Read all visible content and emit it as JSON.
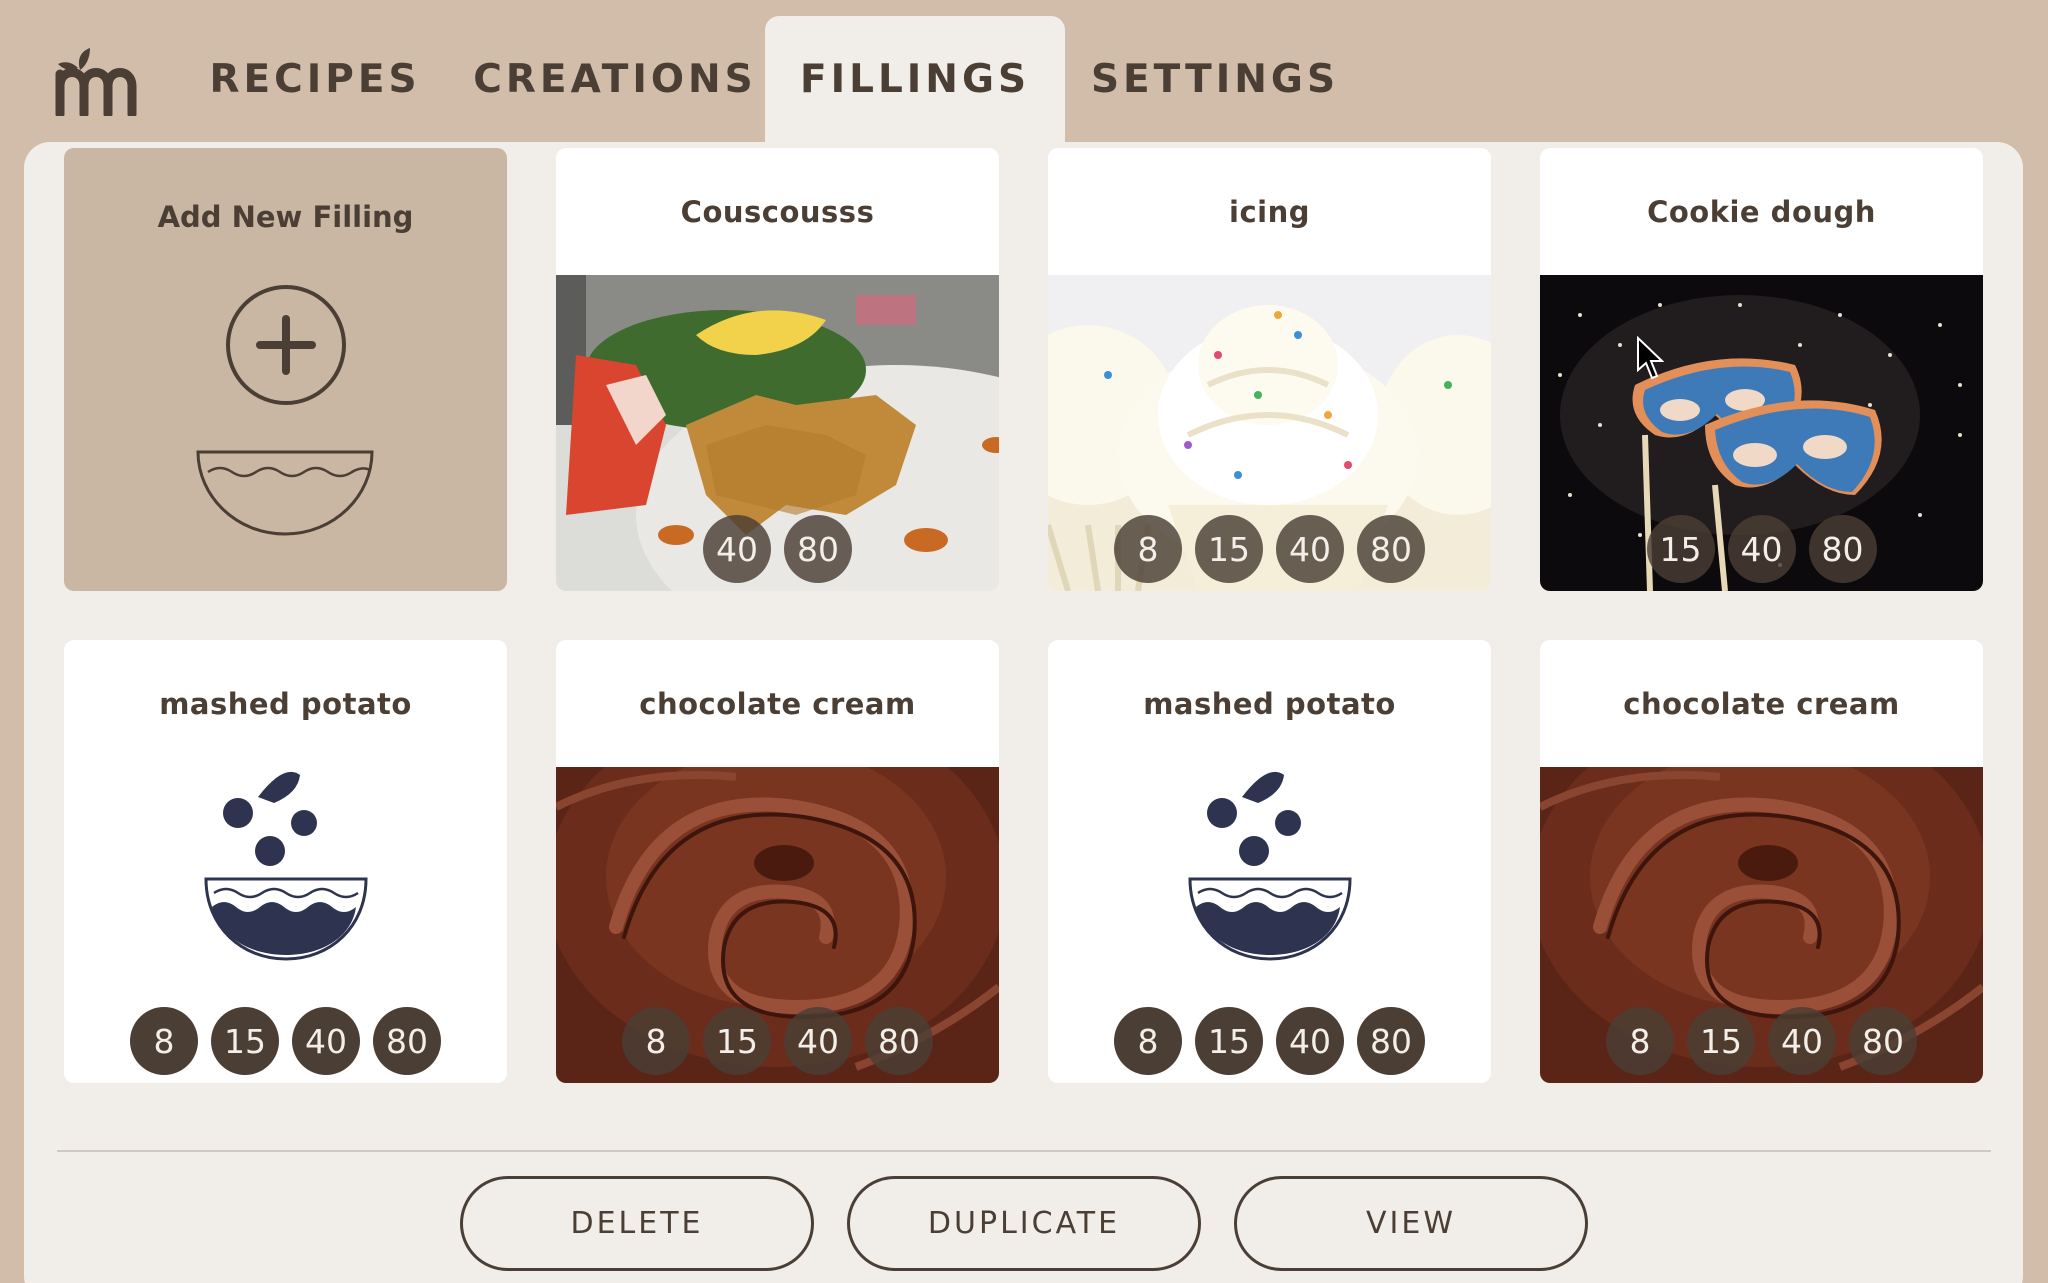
{
  "nav": {
    "logo_text": "m",
    "tabs": [
      {
        "label": "RECIPES"
      },
      {
        "label": "CREATIONS"
      },
      {
        "label": "FILLINGS"
      },
      {
        "label": "SETTINGS"
      }
    ],
    "active_tab": "FILLINGS"
  },
  "add_card": {
    "label": "Add New Filling",
    "icon": "plus-circle-icon",
    "illustration": "bowl-icon"
  },
  "cards": [
    {
      "title": "Couscousss",
      "image": "couscous-photo",
      "sizes": [
        "40",
        "80"
      ]
    },
    {
      "title": "icing",
      "image": "cupcake-icing-photo",
      "sizes": [
        "8",
        "15",
        "40",
        "80"
      ]
    },
    {
      "title": "Cookie dough",
      "image": "mask-cookie-photo",
      "sizes": [
        "15",
        "40",
        "80"
      ]
    },
    {
      "title": "mashed potato",
      "image": "bowl-illustration",
      "sizes": [
        "8",
        "15",
        "40",
        "80"
      ]
    },
    {
      "title": "chocolate cream",
      "image": "chocolate-swirl-photo",
      "sizes": [
        "8",
        "15",
        "40",
        "80"
      ]
    },
    {
      "title": "mashed potato",
      "image": "bowl-illustration",
      "sizes": [
        "8",
        "15",
        "40",
        "80"
      ]
    },
    {
      "title": "chocolate cream",
      "image": "chocolate-swirl-photo",
      "sizes": [
        "8",
        "15",
        "40",
        "80"
      ]
    }
  ],
  "actions": {
    "delete_label": "DELETE",
    "duplicate_label": "DUPLICATE",
    "view_label": "VIEW"
  },
  "colors": {
    "background": "#d1bdaa",
    "panel": "#f1eee9",
    "accent_dark": "#4a3e35",
    "add_card": "#c9b6a3"
  }
}
